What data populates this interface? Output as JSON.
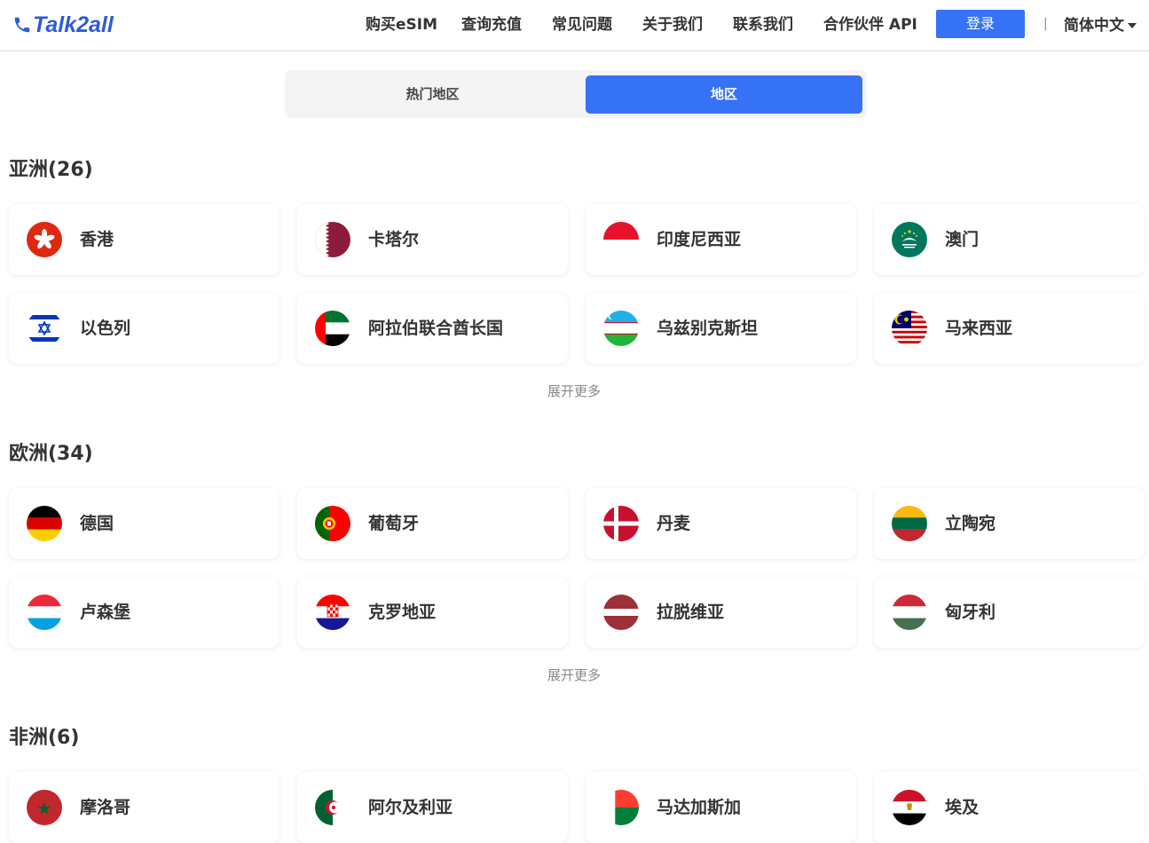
{
  "header": {
    "logo_text": "Talk2all",
    "nav": [
      "购买eSIM",
      "查询充值",
      "常见问题",
      "关于我们",
      "联系我们",
      "合作伙伴 API"
    ],
    "login_label": "登录",
    "separator": "|",
    "language": "简体中文"
  },
  "tabs": {
    "hot": "热门地区",
    "region": "地区",
    "active": "地区"
  },
  "sections": [
    {
      "title": "亚洲(26)",
      "more": "展开更多",
      "countries": [
        "香港",
        "卡塔尔",
        "印度尼西亚",
        "澳门",
        "以色列",
        "阿拉伯联合酋长国",
        "乌兹别克斯坦",
        "马来西亚"
      ]
    },
    {
      "title": "欧洲(34)",
      "more": "展开更多",
      "countries": [
        "德国",
        "葡萄牙",
        "丹麦",
        "立陶宛",
        "卢森堡",
        "克罗地亚",
        "拉脱维亚",
        "匈牙利"
      ]
    },
    {
      "title": "非洲(6)",
      "countries": [
        "摩洛哥",
        "阿尔及利亚",
        "马达加斯加",
        "埃及"
      ]
    }
  ],
  "colors": {
    "accent": "#3672f6",
    "brand": "#2f5bd9"
  }
}
